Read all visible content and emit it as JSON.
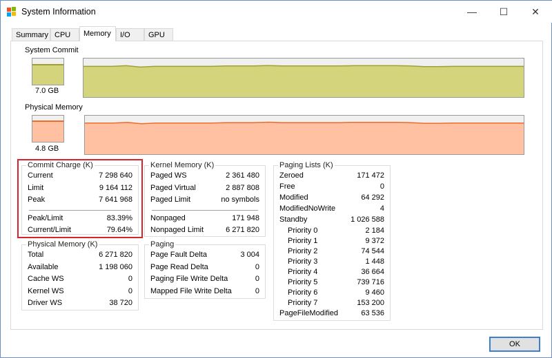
{
  "window": {
    "title": "System Information",
    "minimize": "—",
    "maximize": "☐",
    "close": "✕"
  },
  "tabs": [
    {
      "label": "Summary"
    },
    {
      "label": "CPU"
    },
    {
      "label": "Memory",
      "selected": true
    },
    {
      "label": "I/O"
    },
    {
      "label": "GPU"
    }
  ],
  "colors": {
    "commit_fill": "#d4d47c",
    "commit_line": "#a0a032",
    "physical_fill": "#ffc1a1",
    "physical_line": "#f06a2a",
    "highlight": "#d8232a",
    "graph_bg": "#f0f0f0"
  },
  "system_commit": {
    "label": "System Commit",
    "value": "7.0 GB",
    "gauge_fraction": 0.7964
  },
  "physical_memory_graph": {
    "label": "Physical Memory",
    "value": "4.8 GB",
    "gauge_fraction": 0.809
  },
  "commit_charge": {
    "title": "Commit Charge (K)",
    "rows": [
      {
        "label": "Current",
        "value": "7 298 640"
      },
      {
        "label": "Limit",
        "value": "9 164 112"
      },
      {
        "label": "Peak",
        "value": "7 641 968"
      }
    ],
    "ratios": [
      {
        "label": "Peak/Limit",
        "value": "83.39%"
      },
      {
        "label": "Current/Limit",
        "value": "79.64%"
      }
    ]
  },
  "kernel_memory": {
    "title": "Kernel Memory (K)",
    "rows": [
      {
        "label": "Paged WS",
        "value": "2 361 480"
      },
      {
        "label": "Paged Virtual",
        "value": "2 887 808"
      },
      {
        "label": "Paged Limit",
        "value": "no symbols"
      }
    ],
    "rows2": [
      {
        "label": "Nonpaged",
        "value": "171 948"
      },
      {
        "label": "Nonpaged Limit",
        "value": "6 271 820"
      }
    ]
  },
  "physical_memory": {
    "title": "Physical Memory (K)",
    "rows": [
      {
        "label": "Total",
        "value": "6 271 820"
      },
      {
        "label": "Available",
        "value": "1 198 060"
      },
      {
        "label": "Cache WS",
        "value": "0"
      },
      {
        "label": "Kernel WS",
        "value": "0"
      },
      {
        "label": "Driver WS",
        "value": "38 720"
      }
    ]
  },
  "paging": {
    "title": "Paging",
    "rows": [
      {
        "label": "Page Fault Delta",
        "value": "3 004"
      },
      {
        "label": "Page Read Delta",
        "value": "0"
      },
      {
        "label": "Paging File Write Delta",
        "value": "0"
      },
      {
        "label": "Mapped File Write Delta",
        "value": "0"
      }
    ]
  },
  "paging_lists": {
    "title": "Paging Lists (K)",
    "rows": [
      {
        "label": "Zeroed",
        "value": "171 472"
      },
      {
        "label": "Free",
        "value": "0"
      },
      {
        "label": "Modified",
        "value": "64 292"
      },
      {
        "label": "ModifiedNoWrite",
        "value": "4"
      },
      {
        "label": "Standby",
        "value": "1 026 588"
      },
      {
        "label": "Priority 0",
        "value": "2 184",
        "indent": true
      },
      {
        "label": "Priority 1",
        "value": "9 372",
        "indent": true
      },
      {
        "label": "Priority 2",
        "value": "74 544",
        "indent": true
      },
      {
        "label": "Priority 3",
        "value": "1 448",
        "indent": true
      },
      {
        "label": "Priority 4",
        "value": "36 664",
        "indent": true
      },
      {
        "label": "Priority 5",
        "value": "739 716",
        "indent": true
      },
      {
        "label": "Priority 6",
        "value": "9 460",
        "indent": true
      },
      {
        "label": "Priority 7",
        "value": "153 200",
        "indent": true
      },
      {
        "label": "PageFileModified",
        "value": "63 536"
      }
    ]
  },
  "ok_label": "OK"
}
